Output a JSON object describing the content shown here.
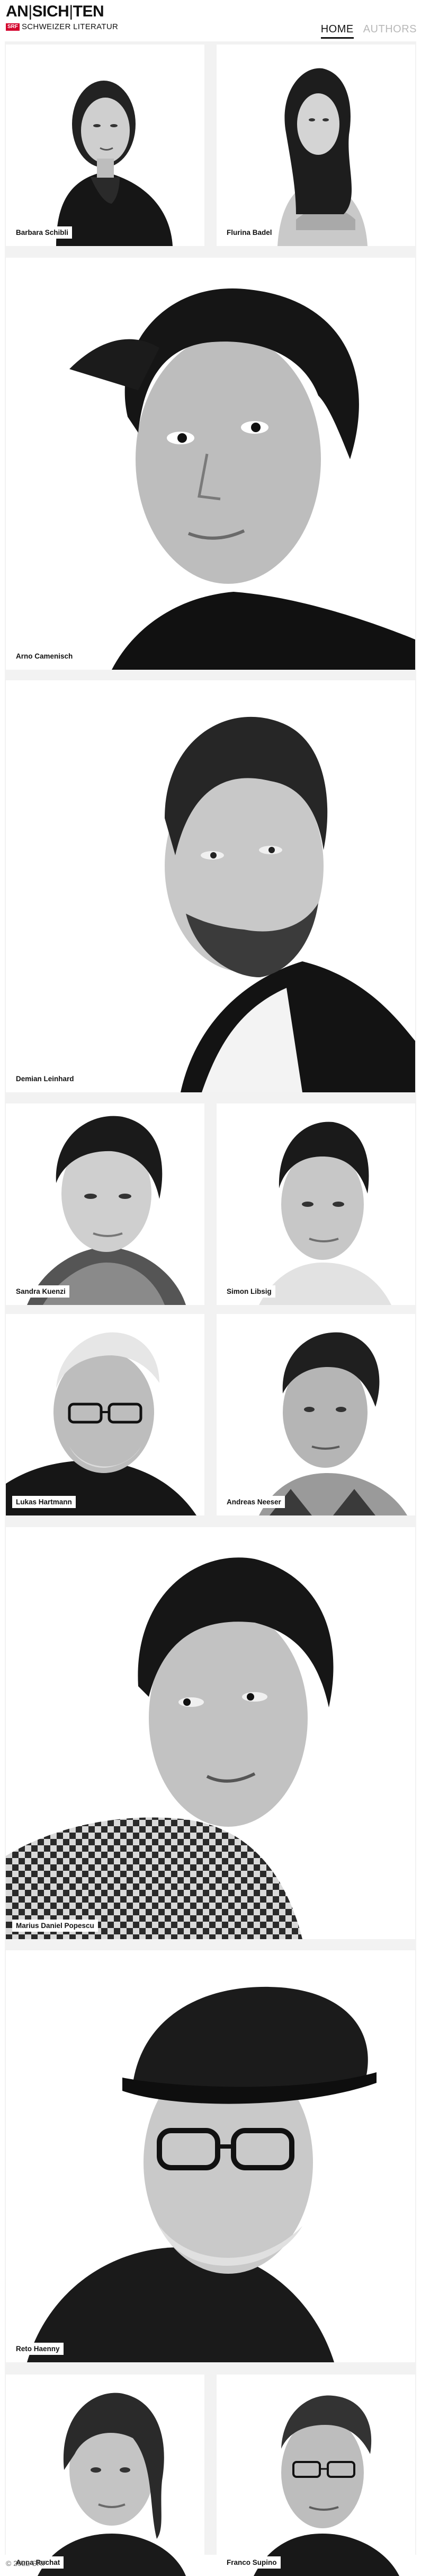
{
  "brand": {
    "title_parts": [
      "AN",
      "|",
      "SICH",
      "|",
      "TEN"
    ],
    "badge": "SRF",
    "subtitle": "SCHWEIZER LITERATUR"
  },
  "nav": {
    "items": [
      {
        "label": "HOME",
        "active": true
      },
      {
        "label": "AUTHORS",
        "active": false
      }
    ]
  },
  "authors": [
    {
      "name": "Barbara Schibli"
    },
    {
      "name": "Flurina Badel"
    },
    {
      "name": "Arno Camenisch"
    },
    {
      "name": "Demian Leinhard"
    },
    {
      "name": "Sandra Kuenzi"
    },
    {
      "name": "Simon Libsig"
    },
    {
      "name": "Lukas Hartmann"
    },
    {
      "name": "Andreas Neeser"
    },
    {
      "name": "Marius Daniel Popescu"
    },
    {
      "name": "Reto Haenny"
    },
    {
      "name": "Anna Ruchat"
    },
    {
      "name": "Franco Supino"
    }
  ],
  "footer": {
    "copyright": "© 2022 SRF"
  },
  "colors": {
    "accent": "#d3002b",
    "text": "#111111",
    "nav_inactive": "#b8b8b8",
    "gallery_bg": "#f2f2f2"
  }
}
